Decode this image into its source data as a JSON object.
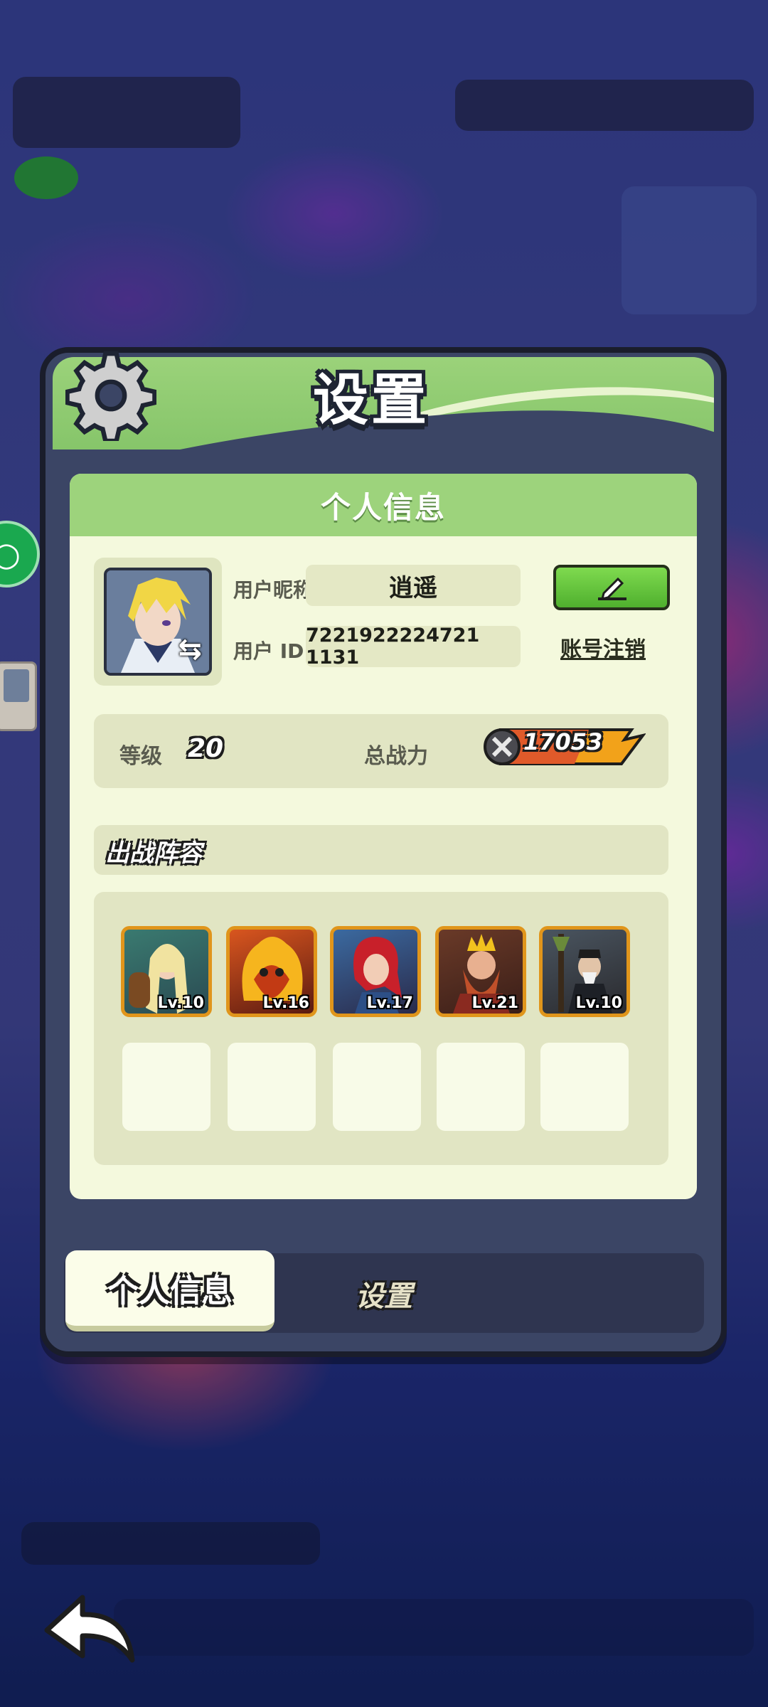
{
  "dialog": {
    "title": "设置",
    "icon": "gear-icon"
  },
  "profile": {
    "section_title": "个人信息",
    "nickname_label": "用户昵称",
    "nickname": "逍遥",
    "id_label": "用户 ID",
    "user_id": "7221922224721 1131",
    "edit_icon": "pencil-icon",
    "cancel_account": "账号注销",
    "swap_icon": "swap-arrows-icon"
  },
  "stats": {
    "level_label": "等级",
    "level": "20",
    "power_label": "总战力",
    "power": "17053"
  },
  "lineup": {
    "title": "出战阵容",
    "heroes": [
      {
        "level": "Lv.10",
        "color": "#2f6e6a"
      },
      {
        "level": "Lv.16",
        "color": "#b8461c"
      },
      {
        "level": "Lv.17",
        "color": "#a2242a"
      },
      {
        "level": "Lv.21",
        "color": "#7a3a22"
      },
      {
        "level": "Lv.10",
        "color": "#4e5258"
      }
    ],
    "empty_slots": 5
  },
  "tabs": {
    "active": "个人信息",
    "settings": "设置"
  },
  "nav": {
    "back_icon": "back-arrow-icon"
  },
  "colors": {
    "header_green": "#9dd37c",
    "panel_dark": "#3b4565",
    "edit_green": "#4fb02e",
    "hero_border": "#e0951b"
  }
}
